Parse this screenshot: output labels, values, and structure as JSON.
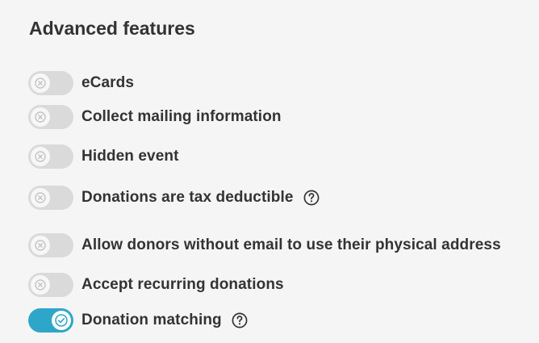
{
  "section": {
    "title": "Advanced features"
  },
  "features": [
    {
      "label": "eCards",
      "enabled": false,
      "toggle_icon": "x-icon"
    },
    {
      "label": "Collect mailing information",
      "enabled": false,
      "toggle_icon": "x-icon"
    },
    {
      "label": "Hidden event",
      "enabled": false,
      "toggle_icon": "x-icon"
    },
    {
      "label": "Donations are tax deductible",
      "enabled": false,
      "toggle_icon": "x-icon",
      "help_icon": "question-circle-icon"
    },
    {
      "label": "Allow donors without email to use their physical address",
      "enabled": false,
      "toggle_icon": "x-icon"
    },
    {
      "label": "Accept recurring donations",
      "enabled": false,
      "toggle_icon": "x-icon"
    },
    {
      "label": "Donation matching",
      "enabled": true,
      "toggle_icon": "check-icon",
      "help_icon": "question-circle-icon"
    }
  ],
  "colors": {
    "toggle_on": "#2ea6c9",
    "toggle_off": "#dadada",
    "text": "#333333",
    "background": "#f5f5f5"
  }
}
